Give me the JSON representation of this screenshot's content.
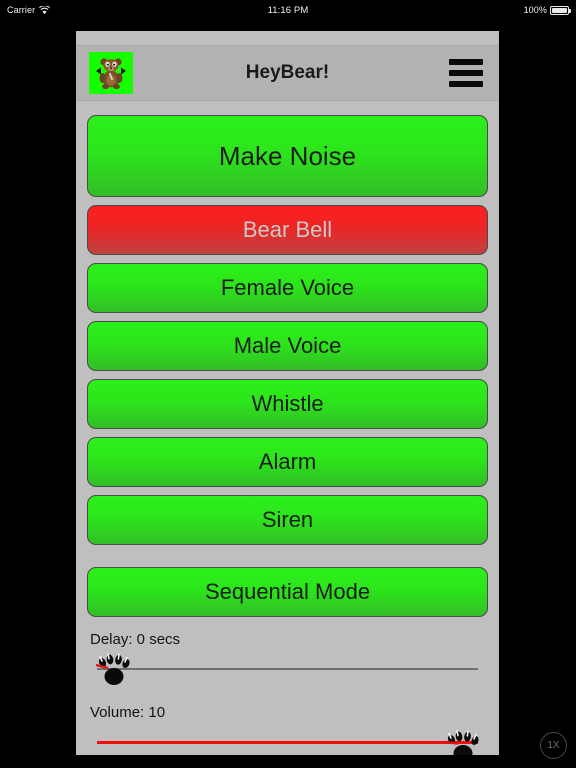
{
  "status_bar": {
    "carrier": "Carrier",
    "wifi_icon": "wifi-icon",
    "time": "11:16 PM",
    "battery_percent": "100%",
    "battery_icon": "battery-icon"
  },
  "navbar": {
    "app_icon": "bear-app-icon",
    "title": "HeyBear!",
    "menu_icon": "hamburger-menu-icon"
  },
  "buttons": [
    {
      "label": "Make Noise",
      "style": "green",
      "size": "hero"
    },
    {
      "label": "Bear Bell",
      "style": "red",
      "size": "row"
    },
    {
      "label": "Female Voice",
      "style": "green",
      "size": "row"
    },
    {
      "label": "Male Voice",
      "style": "green",
      "size": "row"
    },
    {
      "label": "Whistle",
      "style": "green",
      "size": "row"
    },
    {
      "label": "Alarm",
      "style": "green",
      "size": "row"
    },
    {
      "label": "Siren",
      "style": "green",
      "size": "row"
    },
    {
      "label": "Sequential Mode",
      "style": "green",
      "size": "gap"
    }
  ],
  "sliders": {
    "delay": {
      "label": "Delay: 0 secs",
      "value": 0,
      "min": 0,
      "max": 60,
      "thumb_icon": "bear-paw-icon",
      "track_color": "#6f6f6f",
      "position": "left"
    },
    "volume": {
      "label": "Volume: 10",
      "value": 10,
      "min": 0,
      "max": 10,
      "thumb_icon": "bear-paw-icon",
      "track_color": "#f20d0d",
      "position": "right"
    }
  },
  "scale_badge": {
    "label": "1X"
  },
  "colors": {
    "accent_green": "#2bf01a",
    "accent_red": "#f20d0d",
    "app_background": "#bfbfbf",
    "navbar_background": "#b2b2b2"
  }
}
